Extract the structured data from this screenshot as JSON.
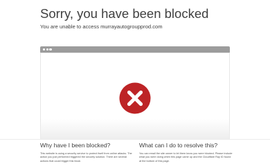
{
  "header": {
    "title": "Sorry, you have been blocked",
    "subtitle": "You are unable to access murrayautogroupprod.com"
  },
  "browser": {
    "icon": "error-x-icon",
    "icon_color": "#bd2426"
  },
  "why": {
    "heading": "Why have I been blocked?",
    "body": "This website is using a security service to protect itself from online attacks. The action you just performed triggered the security solution. There are several actions that could trigger this block"
  },
  "resolve": {
    "heading": "What can I do to resolve this?",
    "body": "You can email the site owner to let them know you were blocked. Please include what you were doing when this page came up and the Cloudflare Ray ID found at the bottom of this page."
  }
}
